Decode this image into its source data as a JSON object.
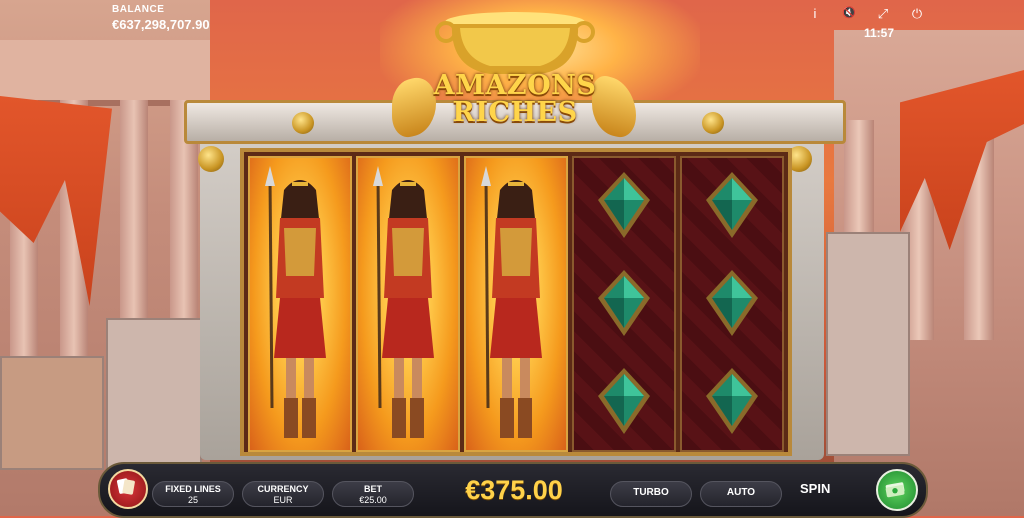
{
  "balance": {
    "label": "BALANCE",
    "value": "€637,298,707.90"
  },
  "top_controls": {
    "info_glyph": "i",
    "mute_glyph": "🔇",
    "fullscreen_glyph": "⤢",
    "power_glyph": "⏻",
    "clock": "11:57"
  },
  "logo": {
    "line1": "AMAZONS",
    "line2": "RICHES"
  },
  "reels": [
    {
      "symbol": "amazon-warrior",
      "style": "fire"
    },
    {
      "symbol": "amazon-warrior",
      "style": "fire"
    },
    {
      "symbol": "amazon-warrior",
      "style": "fire"
    },
    {
      "symbol": "green-gem",
      "style": "dark"
    },
    {
      "symbol": "green-gem",
      "style": "dark"
    }
  ],
  "bottom_bar": {
    "fixed_lines_label": "FIXED LINES",
    "fixed_lines_value": "25",
    "currency_label": "CURRENCY",
    "currency_value": "EUR",
    "bet_label": "BET",
    "bet_value": "€25.00",
    "win_amount": "€375.00",
    "turbo_label": "TURBO",
    "auto_label": "AUTO",
    "spin_label": "SPIN"
  },
  "colors": {
    "accent_gold": "#ffd24a",
    "spin_green": "#2aa83a",
    "cards_red": "#c0262a",
    "gem_green": "#1e8a6a"
  }
}
